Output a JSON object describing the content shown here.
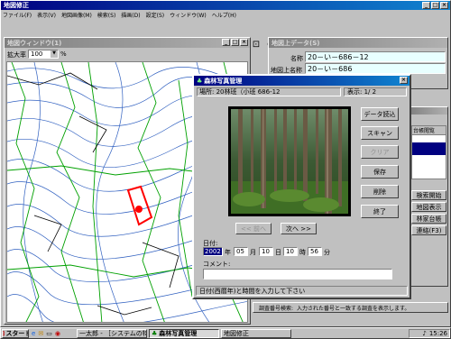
{
  "app": {
    "title": "地図修正",
    "menu": [
      "ファイル(F)",
      "表示(V)",
      "地図画像(M)",
      "検索(S)",
      "描画(D)",
      "設定(S)",
      "ウィンドウ(W)",
      "ヘルプ(H)"
    ]
  },
  "map_window": {
    "title": "地図ウィンドウ(1)",
    "zoom_label": "拡大率",
    "zoom_value": "100",
    "zoom_unit": "%"
  },
  "data_window": {
    "title": "地図上データ(S)",
    "name_label": "名称",
    "name_value": "20－い－686－12",
    "map_name_label": "地図上名称",
    "map_name_value": "20－い－686"
  },
  "side_panel": {
    "label": "台帳閲覧",
    "buttons": [
      "検索開始",
      "地図表示",
      "林家台帳",
      "連絡(F3)"
    ]
  },
  "dialog": {
    "title": "森林写真管理",
    "location": "場所: 20林班（小班 686-12",
    "display": "表示: 1/ 2",
    "buttons": {
      "read": "データ読込",
      "scan": "スキャン",
      "clear": "クリア",
      "save": "保存",
      "delete": "削除",
      "end": "終了"
    },
    "prev": "<< 前へ",
    "next": "次へ >>",
    "date_label": "日付:",
    "year": "2002",
    "year_unit": "年",
    "month": "05",
    "month_unit": "月",
    "day": "10",
    "day_unit": "日",
    "hour": "10",
    "hour_unit": "時",
    "minute": "56",
    "minute_unit": "分",
    "comment_label": "コメント:",
    "comment": "",
    "status": "日付(西暦年)と時間を入力して下さい"
  },
  "bottom_status": {
    "label": "調査番号検索:",
    "text": "入力された番号と一致する調査を表示します。"
  },
  "taskbar": {
    "start": "スタート",
    "tasks": [
      "一太郎 - ［システムの特徴...",
      "森林写真管理",
      "地図修正"
    ],
    "clock": "15:26"
  }
}
